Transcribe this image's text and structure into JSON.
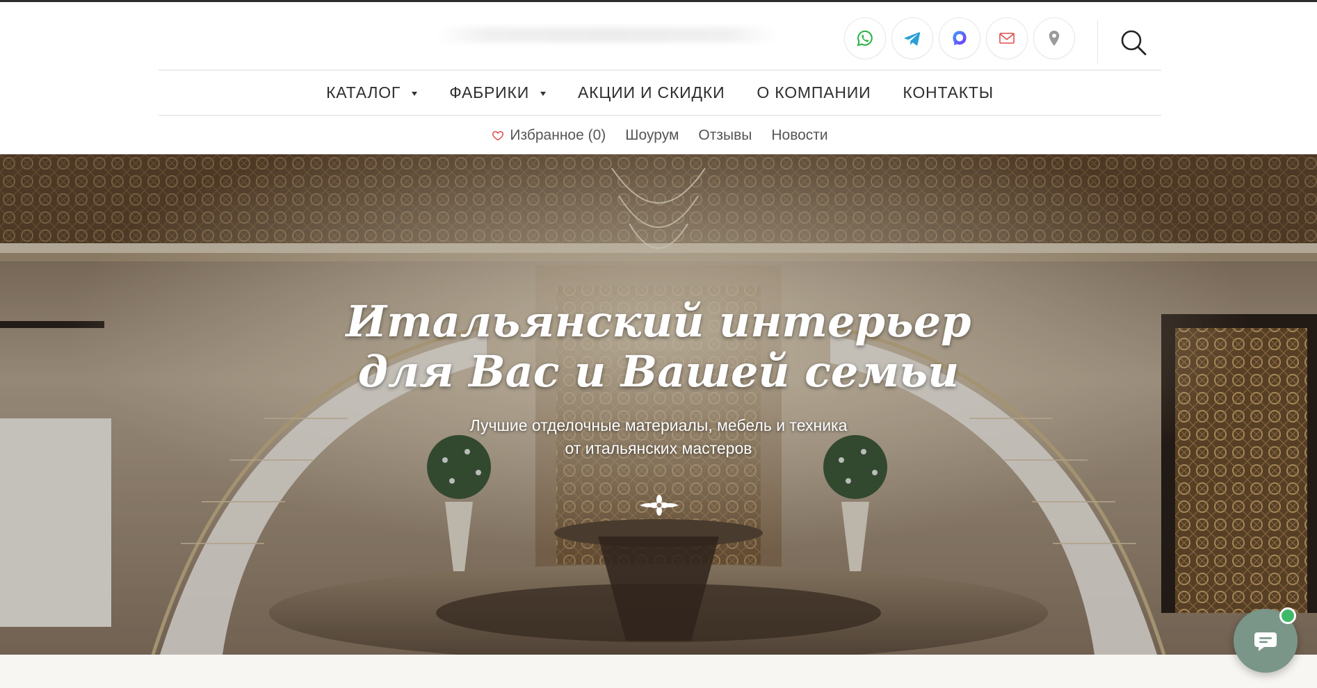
{
  "header": {
    "socials": [
      {
        "name": "whatsapp-icon",
        "color": "#2fb447"
      },
      {
        "name": "telegram-icon",
        "color": "#2a9fd6"
      },
      {
        "name": "max-messenger-icon",
        "color": "#4b3df0"
      },
      {
        "name": "mail-icon",
        "color": "#e04b4b"
      },
      {
        "name": "location-pin-icon",
        "color": "#9a9a9a"
      }
    ],
    "search_icon": "search-icon"
  },
  "nav": {
    "catalog": "КАТАЛОГ",
    "factories": "ФАБРИКИ",
    "sales": "АКЦИИ И СКИДКИ",
    "about": "О КОМПАНИИ",
    "contacts": "КОНТАКТЫ"
  },
  "subnav": {
    "favorites": "Избранное (0)",
    "showroom": "Шоурум",
    "reviews": "Отзывы",
    "news": "Новости"
  },
  "hero": {
    "title_line1": "Итальянский интерьер",
    "title_line2": "для Вас и Вашей семьи",
    "subtitle_line1": "Лучшие отделочные материалы, мебель и техника",
    "subtitle_line2": "от итальянских мастеров"
  },
  "chat": {
    "icon": "chat-bubble-icon",
    "status_color": "#3fb86a"
  }
}
